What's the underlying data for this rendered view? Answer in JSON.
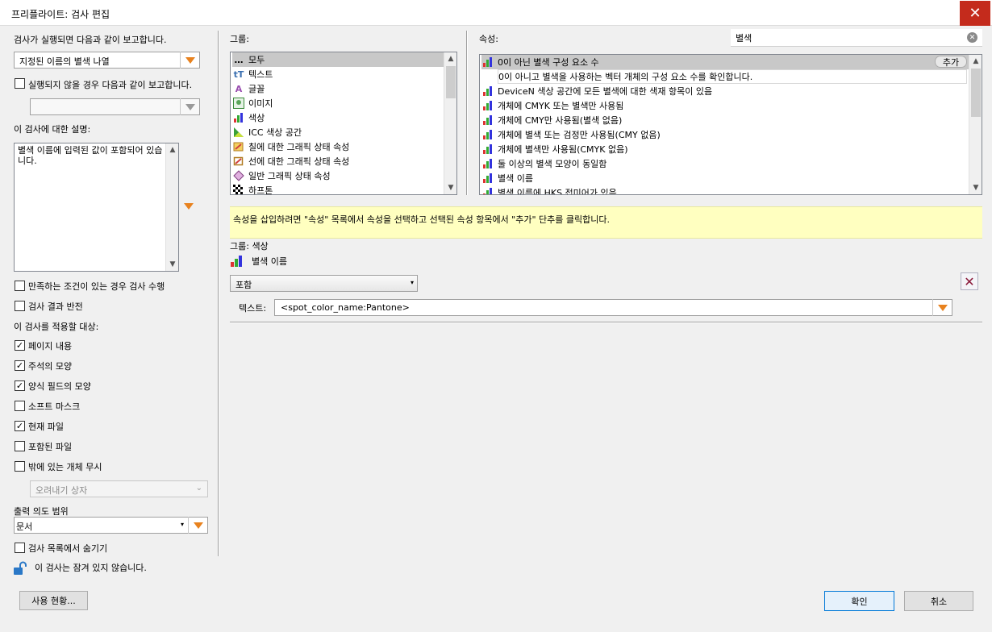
{
  "window": {
    "title": "프리플라이트: 검사 편집",
    "close_glyph": "✕"
  },
  "left": {
    "report_label": "검사가 실행되면 다음과 같이 보고합니다.",
    "report_select": "지정된 이름의 별색 나열",
    "not_run_label": "실행되지 않을 경우 다음과 같이 보고합니다.",
    "not_run_select": "",
    "description_label": "이 검사에 대한 설명:",
    "description_text": "별색 이름에 입력된 값이 포함되어 있습니다.",
    "checkboxes": [
      {
        "label": "만족하는 조건이 있는 경우 검사 수행",
        "checked": false
      },
      {
        "label": "검사 결과 반전",
        "checked": false
      }
    ],
    "apply_label": "이 검사를 적용할 대상:",
    "apply_items": [
      {
        "label": "페이지 내용",
        "checked": true
      },
      {
        "label": "주석의 모양",
        "checked": true
      },
      {
        "label": "양식 필드의 모양",
        "checked": true
      },
      {
        "label": "소프트 마스크",
        "checked": false
      },
      {
        "label": "현재 파일",
        "checked": true
      },
      {
        "label": "포함된 파일",
        "checked": false
      },
      {
        "label": "밖에 있는 개체 무시",
        "checked": false
      }
    ],
    "trim_select": "오려내기 상자",
    "output_label": "출력 의도 범위",
    "output_select": "문서",
    "hide_label": "검사 목록에서 숨기기",
    "hide_checked": false,
    "lock_text": "이 검사는 잠겨 있지 않습니다.",
    "usage_button": "사용 현황..."
  },
  "groups": {
    "label": "그룹:",
    "items": [
      {
        "label": "모두",
        "icon": "ellipsis-icon"
      },
      {
        "label": "텍스트",
        "icon": "text-icon"
      },
      {
        "label": "글꼴",
        "icon": "font-icon"
      },
      {
        "label": "이미지",
        "icon": "image-icon"
      },
      {
        "label": "색상",
        "icon": "color-icon"
      },
      {
        "label": "ICC 색상 공간",
        "icon": "icc-icon"
      },
      {
        "label": "칠에 대한 그래픽 상태 속성",
        "icon": "fill-icon"
      },
      {
        "label": "선에 대한 그래픽 상태 속성",
        "icon": "stroke-icon"
      },
      {
        "label": "일반 그래픽 상태 속성",
        "icon": "graphic-state-icon"
      },
      {
        "label": "하프톤",
        "icon": "halftone-icon"
      }
    ]
  },
  "properties": {
    "label": "속성:",
    "search_value": "별색",
    "add_button": "추가",
    "items": [
      {
        "label": "0이 아닌 별색 구성 요소 수"
      },
      {
        "label": "0이 아니고 별색을 사용하는 벡터 개체의 구성 요소 수를 확인합니다."
      },
      {
        "label": "DeviceN 색상 공간에 모든 별색에 대한 색재 항목이 있음"
      },
      {
        "label": "개체에 CMYK 또는 별색만 사용됨"
      },
      {
        "label": "개체에 CMY만 사용됨(별색 없음)"
      },
      {
        "label": "개체에 별색 또는 검정만 사용됨(CMY 없음)"
      },
      {
        "label": "개체에 별색만 사용됨(CMYK 없음)"
      },
      {
        "label": "둘 이상의 별색 모양이 동일함"
      },
      {
        "label": "별색 이름"
      },
      {
        "label": "별색 이름에 HKS 접미어가 있음"
      }
    ]
  },
  "hint": "속성을 삽입하려면 \"속성\" 목록에서 속성을 선택하고 선택된 속성 항목에서 \"추가\" 단추를 클릭합니다.",
  "condition": {
    "group_label": "그룹: 색상",
    "property_name": "별색 이름",
    "operator": "포함",
    "text_label": "텍스트:",
    "text_value": "<spot_color_name:Pantone>"
  },
  "buttons": {
    "ok": "확인",
    "cancel": "취소"
  },
  "colors": {
    "accent": "#e8821e",
    "close": "#c42b1c",
    "hint_bg": "#ffffc0"
  }
}
